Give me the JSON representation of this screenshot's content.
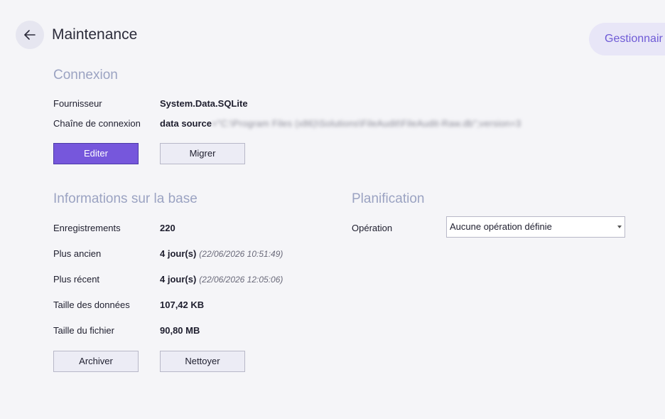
{
  "header": {
    "title": "Maintenance",
    "right_button_label": "Gestionnair"
  },
  "connexion": {
    "title": "Connexion",
    "provider_label": "Fournisseur",
    "provider_value": "System.Data.SQLite",
    "connection_string_label": "Chaîne de connexion",
    "connection_string_prefix": "data source",
    "connection_string_blurred": "=\"C:\\Program Files (x86)\\Solutions\\FileAudit\\FileAudit-Raw.db\";version=3",
    "edit_button": "Editer",
    "migrate_button": "Migrer"
  },
  "database_info": {
    "title": "Informations sur la base",
    "records_label": "Enregistrements",
    "records_value": "220",
    "oldest_label": "Plus ancien",
    "oldest_value": "4 jour(s)",
    "oldest_date": "(22/06/2026 10:51:49)",
    "newest_label": "Plus récent",
    "newest_value": "4 jour(s)",
    "newest_date": "(22/06/2026 12:05:06)",
    "data_size_label": "Taille des données",
    "data_size_value": "107,42 KB",
    "file_size_label": "Taille du fichier",
    "file_size_value": "90,80 MB",
    "archive_button": "Archiver",
    "clean_button": "Nettoyer"
  },
  "planning": {
    "title": "Planification",
    "operation_label": "Opération",
    "operation_selected": "Aucune opération définie"
  },
  "icons": {
    "back": "arrow-left-icon",
    "dropdown": "chevron-down-icon"
  },
  "colors": {
    "accent": "#7657dc",
    "section_title": "#9ba3c2",
    "background": "#f5f5f8"
  }
}
